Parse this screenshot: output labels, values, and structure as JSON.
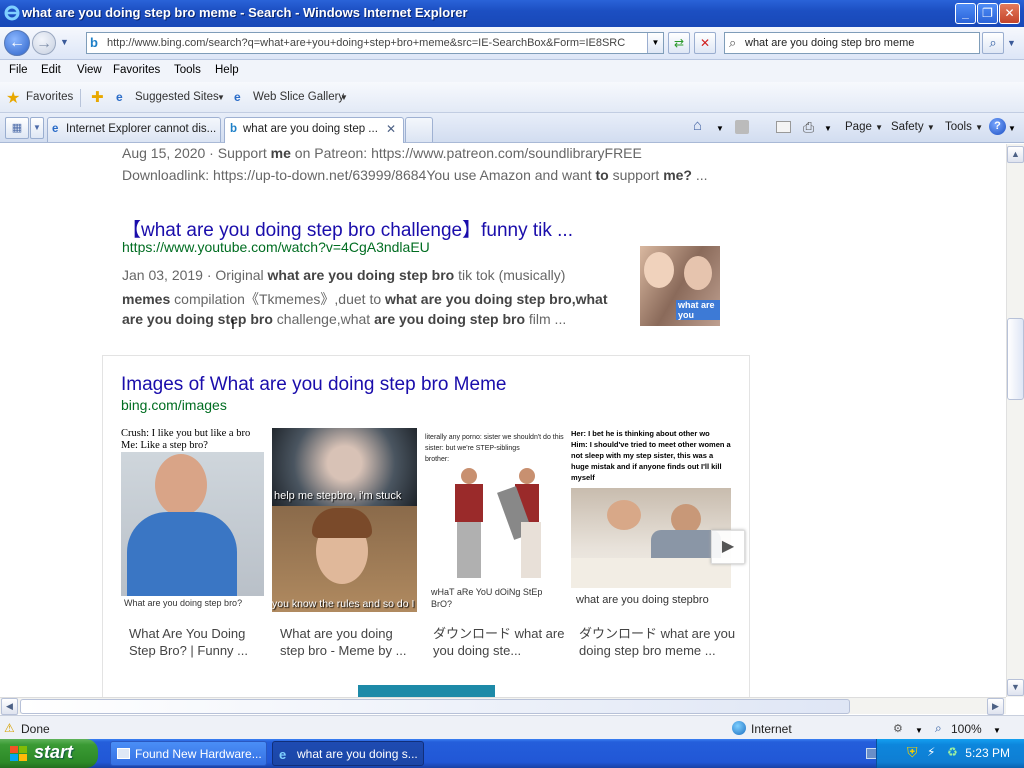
{
  "window": {
    "title": "what are you doing step bro meme - Search - Windows Internet Explorer",
    "buttons": {
      "minimize": "_",
      "maximize": "❐",
      "close": "✕"
    }
  },
  "address_bar": {
    "url": "http://www.bing.com/search?q=what+are+you+doing+step+bro+meme&src=IE-SearchBox&Form=IE8SRC",
    "search_value": "what are you doing step bro meme"
  },
  "menu": [
    "File",
    "Edit",
    "View",
    "Favorites",
    "Tools",
    "Help"
  ],
  "favorites_bar": {
    "favorites_label": "Favorites",
    "suggested_sites": "Suggested Sites",
    "web_slice_gallery": "Web Slice Gallery"
  },
  "tabs": [
    {
      "label": "Internet Explorer cannot dis...",
      "active": false
    },
    {
      "label": "what are you doing step ...",
      "active": true
    }
  ],
  "command_bar": {
    "page": "Page",
    "safety": "Safety",
    "tools": "Tools"
  },
  "content": {
    "result1": {
      "snippet_line1_date": "Aug 15, 2020 · Support ",
      "snippet_line1_bold": "me",
      "snippet_line1_rest": " on Patreon: https://www.patreon.com/soundlibraryFREE",
      "snippet_line2_a": "Downloadlink: https://up-to-down.net/63999/8684You use Amazon and want ",
      "snippet_line2_b1": "to",
      "snippet_line2_mid": " support ",
      "snippet_line2_b2": "me?",
      "snippet_line2_tail": " ..."
    },
    "result2": {
      "title": "【what are you doing step bro challenge】funny tik ...",
      "url": "https://www.youtube.com/watch?v=4CgA3ndlaEU",
      "l1_a": "Jan 03, 2019 · Original ",
      "l1_b": "what are you doing step bro",
      "l1_c": " tik tok (musically)",
      "l2_a": "memes",
      "l2_b": " compilation《Tkmemes》,duet to ",
      "l2_c": "what are you doing step bro,what",
      "l3_a": "are you doing step bro",
      "l3_b": " challenge,what ",
      "l3_c": "are you doing step bro",
      "l3_d": " film ...",
      "thumb_caption": "what are you"
    },
    "images_block": {
      "title": "Images of What are you doing step bro Meme",
      "source": "bing.com/images",
      "images": [
        {
          "top_text": "Crush: I like you but like a bro\nMe: Like a step bro?",
          "bottom_text": "What are you doing step bro?",
          "caption": "What Are You Doing Step Bro? | Funny ..."
        },
        {
          "top_text": "help me stepbro, i'm stuck",
          "bottom_text": "you know the rules and so do I",
          "caption": "What are you doing step bro - Meme by ..."
        },
        {
          "top_text": "literally any porno: sister we shouldn't do this sister: but we're STEP-siblings\nbrother:",
          "bottom_text": "wHaT aRe YoU dOiNg StEp BrO?",
          "caption": "ダウンロード what are you doing ste..."
        },
        {
          "top_text": "Her: I bet he is thinking about other wo\nHim: I should've tried to meet other women a not sleep with my step sister, this was a huge mistak and if anyone finds out I'll kill myself",
          "bottom_text": "what are you doing stepbro",
          "caption": "ダウンロード what are you doing step bro meme ..."
        }
      ],
      "next_arrow": "▶"
    }
  },
  "status_bar": {
    "status": "Done",
    "zone": "Internet",
    "zoom": "100%"
  },
  "taskbar": {
    "start": "start",
    "tasks": [
      {
        "label": "Found New Hardware...",
        "active": false
      },
      {
        "label": "what are you doing s...",
        "active": true
      }
    ],
    "clock": "5:23 PM"
  }
}
